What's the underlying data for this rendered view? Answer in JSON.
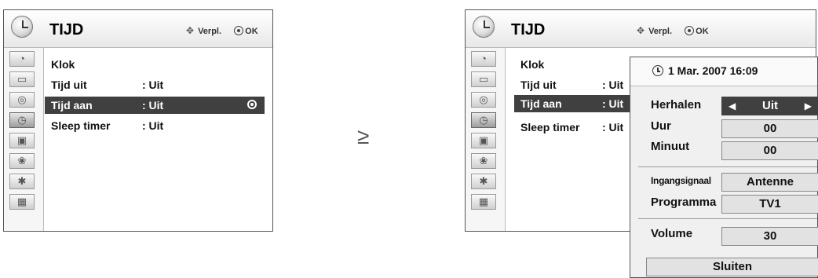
{
  "left_menu": {
    "title": "TIJD",
    "nav_move": "Verpl.",
    "nav_ok": "OK",
    "rows": [
      {
        "label": "Klok",
        "value": ""
      },
      {
        "label": "Tijd uit",
        "value": ": Uit"
      },
      {
        "label": "Tijd aan",
        "value": ": Uit",
        "selected": true
      },
      {
        "label": "Sleep timer",
        "value": ": Uit"
      }
    ],
    "side_icons": [
      "satellite-dish-icon",
      "tv-screen-icon",
      "speaker-icon",
      "clock-icon",
      "toolbox-icon",
      "lock-icon",
      "bluetooth-icon",
      "clapperboard-icon"
    ],
    "active_icon": "clock-icon"
  },
  "separator_glyph": "≥",
  "right_menu": {
    "title": "TIJD",
    "nav_move": "Verpl.",
    "nav_ok": "OK",
    "rows": [
      {
        "label": "Klok",
        "value": ""
      },
      {
        "label": "Tijd uit",
        "value": ": Uit"
      },
      {
        "label": "Tijd aan",
        "value": ": Uit",
        "selected": true
      },
      {
        "label": "Sleep timer",
        "value": ": Uit"
      }
    ]
  },
  "popup": {
    "datetime": "1 Mar. 2007 16:09",
    "herhalen_label": "Herhalen",
    "herhalen_value": "Uit",
    "uur_label": "Uur",
    "uur_value": "00",
    "minuut_label": "Minuut",
    "minuut_value": "00",
    "input_label": "Ingangsignaal",
    "input_value": "Antenne",
    "programma_label": "Programma",
    "programma_value": "TV1",
    "volume_label": "Volume",
    "volume_value": "30",
    "close_label": "Sluiten"
  },
  "colors": {
    "selected_bg": "#404040",
    "field_bg": "#e2e2e2",
    "popup_bg": "#f0f0f0"
  }
}
